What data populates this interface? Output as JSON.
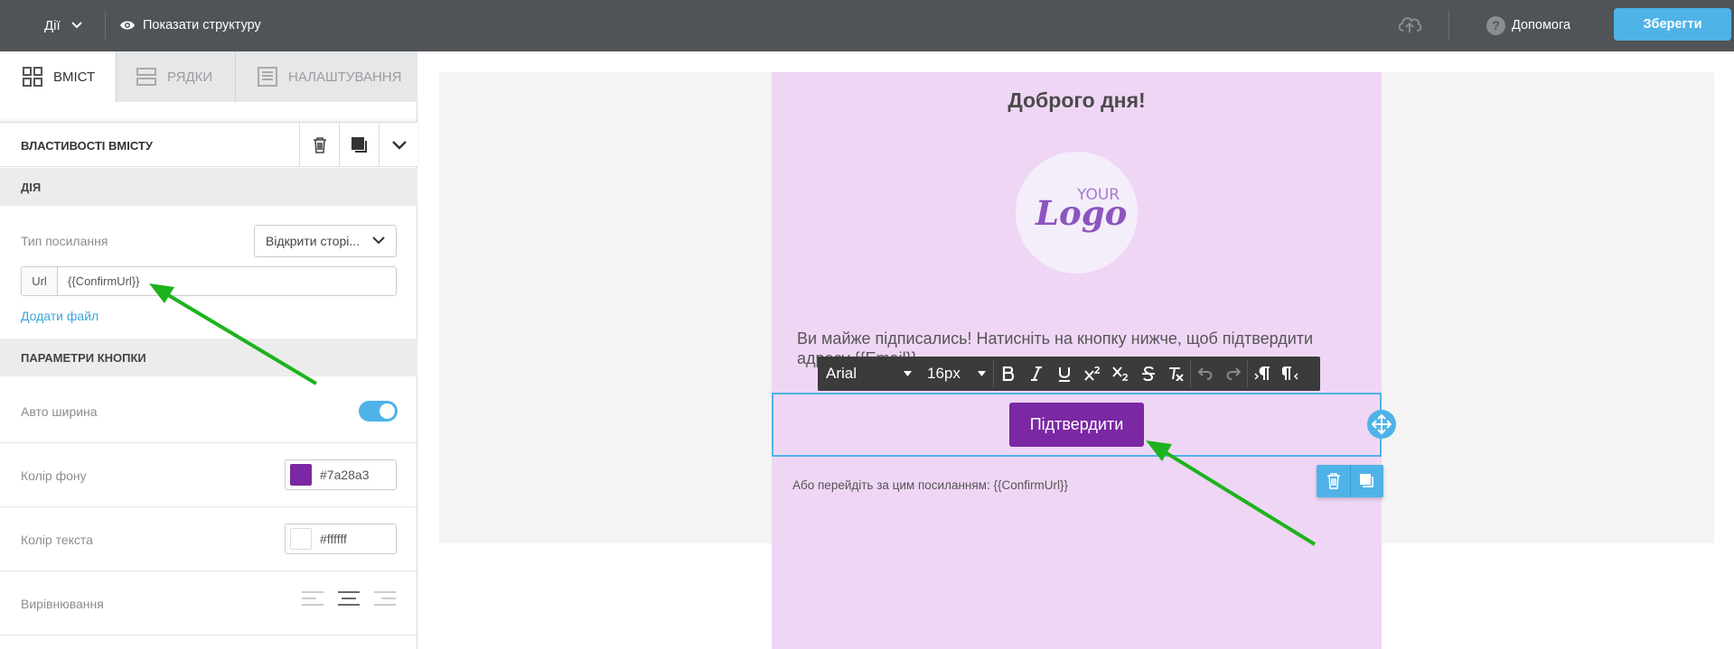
{
  "topbar": {
    "actions_label": "Дії",
    "structure_label": "Показати структуру",
    "help_label": "Допомога",
    "help_icon_text": "?",
    "save_label": "Зберегти"
  },
  "sidebar": {
    "tabs": [
      {
        "label": "ВМІСТ",
        "active": true,
        "icon": "grid-icon"
      },
      {
        "label": "РЯДКИ",
        "active": false,
        "icon": "rows-icon"
      },
      {
        "label": "НАЛАШТУВАННЯ",
        "active": false,
        "icon": "settings-doc-icon"
      }
    ],
    "props_title": "ВЛАСТИВОСТІ ВМІСТУ",
    "action_section": "ДІЯ",
    "link_type_label": "Тип посилання",
    "link_type_value": "Відкрити сторі...",
    "url_prefix": "Url",
    "url_value": "{{ConfirmUrl}}",
    "add_file_label": "Додати файл",
    "button_params_section": "ПАРАМЕТРИ КНОПКИ",
    "auto_width_label": "Авто ширина",
    "auto_width_on": true,
    "bg_color_label": "Колір фону",
    "bg_color_value": "#7a28a3",
    "text_color_label": "Колір текста",
    "text_color_value": "#ffffff",
    "align_label": "Вирівнювання",
    "align_selected": "center"
  },
  "email": {
    "greeting": "Доброго дня!",
    "logo_your": "YOUR",
    "logo_logo": "Logo",
    "body_text": "Ви майже підписались! Натисніть на кнопку нижче, щоб підтвердити адресу {{Email}}",
    "button_label": "Підтвердити",
    "alt_link_text": "Або перейдіть за цим посиланням: {{ConfirmUrl}}",
    "background": "#efd6f5"
  },
  "toolbar": {
    "font": "Arial",
    "size": "16px",
    "buttons": [
      "bold-icon",
      "italic-icon",
      "underline-icon",
      "superscript-icon",
      "subscript-icon",
      "strikethrough-icon",
      "clear-format-icon",
      "undo-icon",
      "redo-icon",
      "ltr-icon",
      "rtl-icon"
    ]
  },
  "colors": {
    "accent": "#4fb3e8",
    "topbar": "#505357",
    "annotation_arrow": "#1db31d"
  }
}
